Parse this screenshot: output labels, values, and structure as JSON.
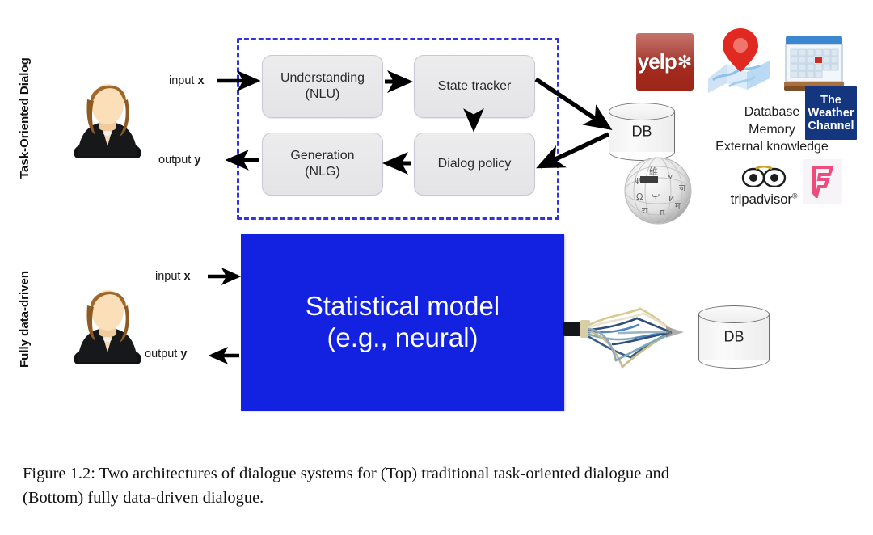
{
  "figure": {
    "rows": [
      {
        "label": "Task-Oriented Dialog"
      },
      {
        "label": "Fully data-driven"
      }
    ],
    "top": {
      "io": {
        "input": "input ",
        "input_var": "x",
        "output": "output ",
        "output_var": "y"
      },
      "modules": [
        {
          "name": "understanding",
          "line1": "Understanding",
          "line2": "(NLU)"
        },
        {
          "name": "state-tracker",
          "line1": "State tracker",
          "line2": ""
        },
        {
          "name": "dialog-policy",
          "line1": "Dialog policy",
          "line2": ""
        },
        {
          "name": "generation",
          "line1": "Generation",
          "line2": "(NLG)"
        }
      ],
      "db_label": "DB",
      "knowledge_lines": [
        "Database",
        "Memory",
        "External knowledge"
      ],
      "logos": [
        {
          "name": "yelp",
          "text": "yelp",
          "mark": "✻"
        },
        {
          "name": "maps",
          "text": ""
        },
        {
          "name": "calendar",
          "text": ""
        },
        {
          "name": "the-weather-channel",
          "line1": "The",
          "line2": "Weather",
          "line3": "Channel"
        },
        {
          "name": "wikipedia",
          "text": ""
        },
        {
          "name": "tripadvisor",
          "text": "tripadvisor",
          "sup": "®"
        },
        {
          "name": "foursquare",
          "text": ""
        }
      ]
    },
    "bottom": {
      "io": {
        "input": "input ",
        "input_var": "x",
        "output": "output ",
        "output_var": "y"
      },
      "model_line1": "Statistical model",
      "model_line2": "(e.g., neural)",
      "db_label": "DB"
    },
    "colors": {
      "dashed_border": "#3333dd",
      "model_box": "#1322e0",
      "module_box": "#e8e8ea",
      "yelp_red": "#a32b1f",
      "weather_blue": "#14367e",
      "foursquare_pink": "#ef4b7c",
      "arrow": "#000000"
    }
  },
  "caption": {
    "line1": "Figure 1.2:  Two architectures of dialogue systems for (Top) traditional task-oriented dialogue and",
    "line2": "(Bottom) fully data-driven dialogue."
  }
}
